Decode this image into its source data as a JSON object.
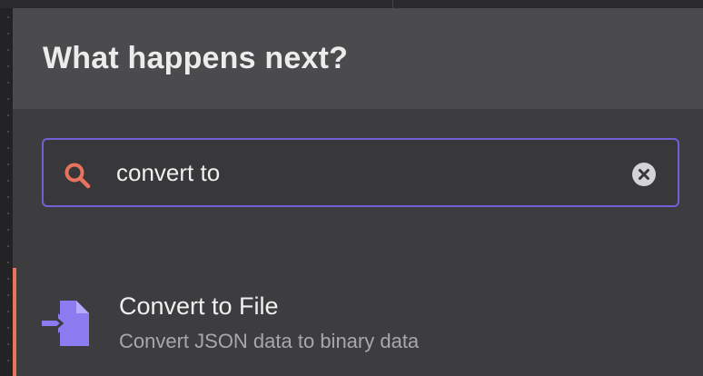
{
  "header": {
    "title": "What happens next?"
  },
  "search": {
    "value": "convert to",
    "icon": "search-icon",
    "clear_icon": "clear-icon"
  },
  "results": [
    {
      "title": "Convert to File",
      "description": "Convert JSON data to binary data",
      "icon": "convert-to-file-icon",
      "selected": true
    }
  ],
  "colors": {
    "accent_border": "#7061d6",
    "selection_accent": "#e9735c",
    "search_icon": "#e9735c",
    "node_icon": "#8c7cf2",
    "panel_bg": "#3d3d40",
    "header_bg": "#4b4b4e"
  }
}
